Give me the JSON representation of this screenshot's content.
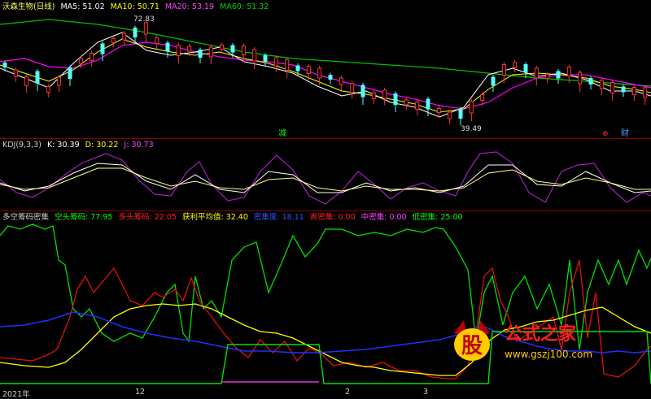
{
  "price_panel": {
    "stock_name": "沃森生物(日线)",
    "ma5": {
      "label": "MA5: 51.02",
      "color": "#ffffff"
    },
    "ma10": {
      "label": "MA10: 50.71",
      "color": "#ffff00"
    },
    "ma20": {
      "label": "MA20: 53.19",
      "color": "#ff00ff"
    },
    "ma60": {
      "label": "MA60: 51.32",
      "color": "#00c000"
    },
    "high_marker": "72.83",
    "low_marker": "39.49",
    "mark_jian": "减",
    "mark_cai": "财",
    "mark_red": "⊕"
  },
  "kdj_panel": {
    "title": "KDJ(9,3,3)",
    "k": "K: 30.39",
    "d": "D: 30.22",
    "j": "J: 30.73"
  },
  "chip_panel": {
    "title": "多空筹码密集",
    "kong": "空头筹码: 77.95",
    "duo": "多头筹码: 22.05",
    "avg": "获利平均值: 32.40",
    "dense": "密集度: 18.11",
    "high": "高密集: 0.00",
    "mid": "中密集: 0.00",
    "low": "低密集: 25.00"
  },
  "x_axis": {
    "year": "2021年",
    "m12": "12",
    "m2": "2",
    "m3": "3"
  },
  "watermark": {
    "char": "股",
    "text": "公式之家",
    "url": "www.gszj100.com"
  }
}
